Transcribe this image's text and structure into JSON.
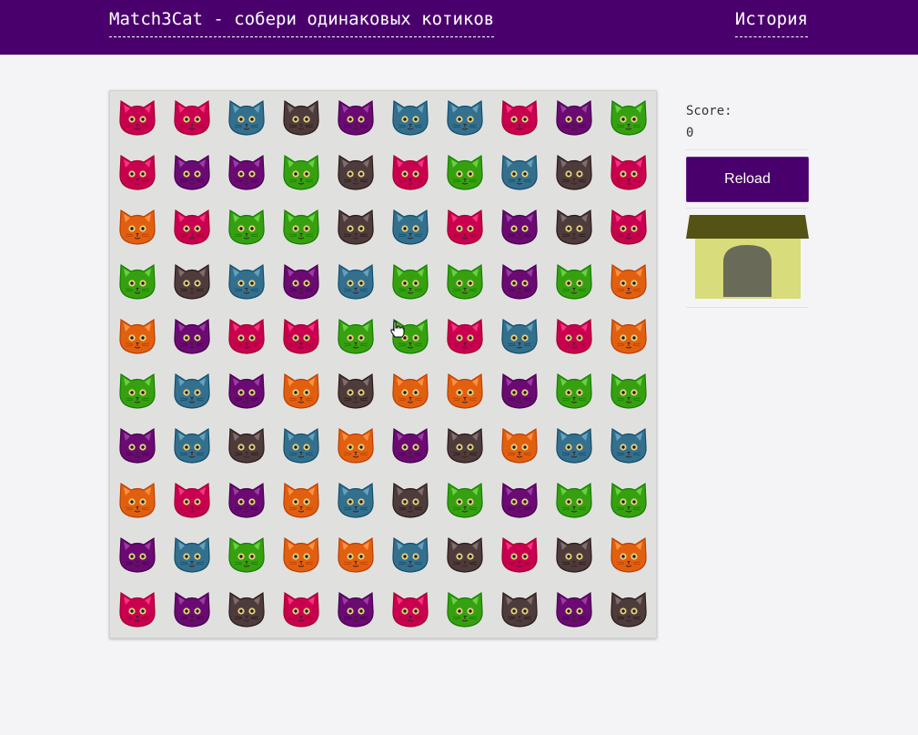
{
  "header": {
    "title": "Match3Cat - собери одинаковых котиков",
    "history_link": "История"
  },
  "sidebar": {
    "score_label": "Score:",
    "score_value": "0",
    "reload_label": "Reload"
  },
  "colors": {
    "header_bg": "#4a006c",
    "board_bg": "#e0e1df",
    "page_bg": "#f4f4f6",
    "cat_red": "#c8004f",
    "cat_purple": "#6a0a72",
    "cat_blue": "#34708e",
    "cat_brown": "#4e3c3c",
    "cat_green": "#36a010",
    "cat_orange": "#e06010"
  },
  "board": {
    "rows": [
      [
        "red",
        "red",
        "blue",
        "brown",
        "purple",
        "blue",
        "blue",
        "red",
        "purple",
        "green"
      ],
      [
        "red",
        "purple",
        "purple",
        "green",
        "brown",
        "red",
        "green",
        "blue",
        "brown",
        "red"
      ],
      [
        "orange",
        "red",
        "green",
        "green",
        "brown",
        "blue",
        "red",
        "purple",
        "brown",
        "red"
      ],
      [
        "green",
        "brown",
        "blue",
        "purple",
        "blue",
        "green",
        "green",
        "purple",
        "green",
        "orange"
      ],
      [
        "orange",
        "purple",
        "red",
        "red",
        "green",
        "green",
        "red",
        "blue",
        "red",
        "orange"
      ],
      [
        "green",
        "blue",
        "purple",
        "orange",
        "brown",
        "orange",
        "orange",
        "purple",
        "green",
        "green"
      ],
      [
        "purple",
        "blue",
        "brown",
        "blue",
        "orange",
        "purple",
        "brown",
        "orange",
        "blue",
        "blue"
      ],
      [
        "orange",
        "red",
        "purple",
        "orange",
        "blue",
        "brown",
        "green",
        "purple",
        "green",
        "green"
      ],
      [
        "purple",
        "blue",
        "green",
        "orange",
        "orange",
        "blue",
        "brown",
        "red",
        "brown",
        "orange"
      ],
      [
        "red",
        "purple",
        "brown",
        "red",
        "purple",
        "red",
        "green",
        "brown",
        "purple",
        "brown"
      ]
    ]
  }
}
